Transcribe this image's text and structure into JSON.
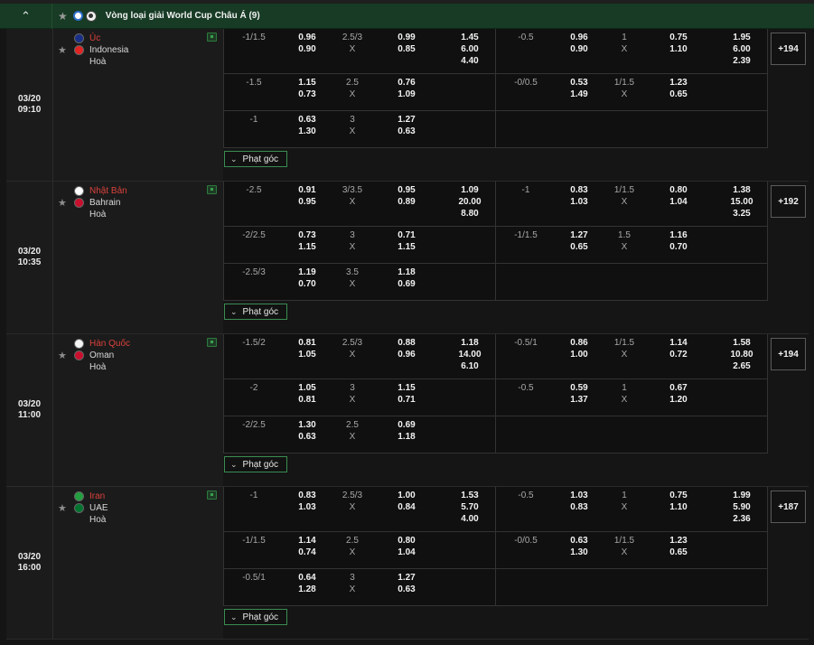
{
  "league": {
    "title": "Vòng loại giải World Cup Châu Á (9)",
    "collapse_icon": "chevron-up-icon",
    "star_icon": "star-icon"
  },
  "corner_label": "Phạt góc",
  "matches": [
    {
      "date": "03/20",
      "time": "09:10",
      "teams": [
        {
          "name": "Úc",
          "fav": true,
          "flag": "#1a2f86"
        },
        {
          "name": "Indonesia",
          "fav": false,
          "flag": "#e02424"
        },
        {
          "name": "Hoà",
          "fav": false,
          "flag": ""
        }
      ],
      "more": "+194",
      "rows": [
        {
          "l_hdp": "-1/1.5",
          "l_o": [
            "0.96",
            "0.90"
          ],
          "l_ou": "2.5/3",
          "l_x": "X",
          "l_uo": [
            "0.99",
            "0.85"
          ],
          "l_1x2": [
            "1.45",
            "6.00",
            "4.40"
          ],
          "r_hdp": "-0.5",
          "r_o": [
            "0.96",
            "0.90"
          ],
          "r_ou": "1",
          "r_x": "X",
          "r_uo": [
            "0.75",
            "1.10"
          ],
          "r_1x2": [
            "1.95",
            "6.00",
            "2.39"
          ]
        },
        {
          "l_hdp": "-1.5",
          "l_o": [
            "1.15",
            "0.73"
          ],
          "l_ou": "2.5",
          "l_x": "X",
          "l_uo": [
            "0.76",
            "1.09"
          ],
          "l_1x2": [
            "",
            "",
            ""
          ],
          "r_hdp": "-0/0.5",
          "r_o": [
            "0.53",
            "1.49"
          ],
          "r_ou": "1/1.5",
          "r_x": "X",
          "r_uo": [
            "1.23",
            "0.65"
          ],
          "r_1x2": [
            "",
            "",
            ""
          ]
        },
        {
          "l_hdp": "-1",
          "l_o": [
            "0.63",
            "1.30"
          ],
          "l_ou": "3",
          "l_x": "X",
          "l_uo": [
            "1.27",
            "0.63"
          ],
          "l_1x2": [
            "",
            "",
            ""
          ],
          "r_hdp": "",
          "r_o": [
            "",
            ""
          ],
          "r_ou": "",
          "r_x": "",
          "r_uo": [
            "",
            ""
          ],
          "r_1x2": [
            "",
            "",
            ""
          ]
        }
      ]
    },
    {
      "date": "03/20",
      "time": "10:35",
      "teams": [
        {
          "name": "Nhật Bản",
          "fav": true,
          "flag": "#ffffff"
        },
        {
          "name": "Bahrain",
          "fav": false,
          "flag": "#c8102e"
        },
        {
          "name": "Hoà",
          "fav": false,
          "flag": ""
        }
      ],
      "more": "+192",
      "rows": [
        {
          "l_hdp": "-2.5",
          "l_o": [
            "0.91",
            "0.95"
          ],
          "l_ou": "3/3.5",
          "l_x": "X",
          "l_uo": [
            "0.95",
            "0.89"
          ],
          "l_1x2": [
            "1.09",
            "20.00",
            "8.80"
          ],
          "r_hdp": "-1",
          "r_o": [
            "0.83",
            "1.03"
          ],
          "r_ou": "1/1.5",
          "r_x": "X",
          "r_uo": [
            "0.80",
            "1.04"
          ],
          "r_1x2": [
            "1.38",
            "15.00",
            "3.25"
          ]
        },
        {
          "l_hdp": "-2/2.5",
          "l_o": [
            "0.73",
            "1.15"
          ],
          "l_ou": "3",
          "l_x": "X",
          "l_uo": [
            "0.71",
            "1.15"
          ],
          "l_1x2": [
            "",
            "",
            ""
          ],
          "r_hdp": "-1/1.5",
          "r_o": [
            "1.27",
            "0.65"
          ],
          "r_ou": "1.5",
          "r_x": "X",
          "r_uo": [
            "1.16",
            "0.70"
          ],
          "r_1x2": [
            "",
            "",
            ""
          ]
        },
        {
          "l_hdp": "-2.5/3",
          "l_o": [
            "1.19",
            "0.70"
          ],
          "l_ou": "3.5",
          "l_x": "X",
          "l_uo": [
            "1.18",
            "0.69"
          ],
          "l_1x2": [
            "",
            "",
            ""
          ],
          "r_hdp": "",
          "r_o": [
            "",
            ""
          ],
          "r_ou": "",
          "r_x": "",
          "r_uo": [
            "",
            ""
          ],
          "r_1x2": [
            "",
            "",
            ""
          ]
        }
      ]
    },
    {
      "date": "03/20",
      "time": "11:00",
      "teams": [
        {
          "name": "Hàn Quốc",
          "fav": true,
          "flag": "#f4f4f4"
        },
        {
          "name": "Oman",
          "fav": false,
          "flag": "#c8102e"
        },
        {
          "name": "Hoà",
          "fav": false,
          "flag": ""
        }
      ],
      "more": "+194",
      "rows": [
        {
          "l_hdp": "-1.5/2",
          "l_o": [
            "0.81",
            "1.05"
          ],
          "l_ou": "2.5/3",
          "l_x": "X",
          "l_uo": [
            "0.88",
            "0.96"
          ],
          "l_1x2": [
            "1.18",
            "14.00",
            "6.10"
          ],
          "r_hdp": "-0.5/1",
          "r_o": [
            "0.86",
            "1.00"
          ],
          "r_ou": "1/1.5",
          "r_x": "X",
          "r_uo": [
            "1.14",
            "0.72"
          ],
          "r_1x2": [
            "1.58",
            "10.80",
            "2.65"
          ]
        },
        {
          "l_hdp": "-2",
          "l_o": [
            "1.05",
            "0.81"
          ],
          "l_ou": "3",
          "l_x": "X",
          "l_uo": [
            "1.15",
            "0.71"
          ],
          "l_1x2": [
            "",
            "",
            ""
          ],
          "r_hdp": "-0.5",
          "r_o": [
            "0.59",
            "1.37"
          ],
          "r_ou": "1",
          "r_x": "X",
          "r_uo": [
            "0.67",
            "1.20"
          ],
          "r_1x2": [
            "",
            "",
            ""
          ]
        },
        {
          "l_hdp": "-2/2.5",
          "l_o": [
            "1.30",
            "0.63"
          ],
          "l_ou": "2.5",
          "l_x": "X",
          "l_uo": [
            "0.69",
            "1.18"
          ],
          "l_1x2": [
            "",
            "",
            ""
          ],
          "r_hdp": "",
          "r_o": [
            "",
            ""
          ],
          "r_ou": "",
          "r_x": "",
          "r_uo": [
            "",
            ""
          ],
          "r_1x2": [
            "",
            "",
            ""
          ]
        }
      ]
    },
    {
      "date": "03/20",
      "time": "16:00",
      "teams": [
        {
          "name": "Iran",
          "fav": true,
          "flag": "#239f40"
        },
        {
          "name": "UAE",
          "fav": false,
          "flag": "#00732f"
        },
        {
          "name": "Hoà",
          "fav": false,
          "flag": ""
        }
      ],
      "more": "+187",
      "rows": [
        {
          "l_hdp": "-1",
          "l_o": [
            "0.83",
            "1.03"
          ],
          "l_ou": "2.5/3",
          "l_x": "X",
          "l_uo": [
            "1.00",
            "0.84"
          ],
          "l_1x2": [
            "1.53",
            "5.70",
            "4.00"
          ],
          "r_hdp": "-0.5",
          "r_o": [
            "1.03",
            "0.83"
          ],
          "r_ou": "1",
          "r_x": "X",
          "r_uo": [
            "0.75",
            "1.10"
          ],
          "r_1x2": [
            "1.99",
            "5.90",
            "2.36"
          ]
        },
        {
          "l_hdp": "-1/1.5",
          "l_o": [
            "1.14",
            "0.74"
          ],
          "l_ou": "2.5",
          "l_x": "X",
          "l_uo": [
            "0.80",
            "1.04"
          ],
          "l_1x2": [
            "",
            "",
            ""
          ],
          "r_hdp": "-0/0.5",
          "r_o": [
            "0.63",
            "1.30"
          ],
          "r_ou": "1/1.5",
          "r_x": "X",
          "r_uo": [
            "1.23",
            "0.65"
          ],
          "r_1x2": [
            "",
            "",
            ""
          ]
        },
        {
          "l_hdp": "-0.5/1",
          "l_o": [
            "0.64",
            "1.28"
          ],
          "l_ou": "3",
          "l_x": "X",
          "l_uo": [
            "1.27",
            "0.63"
          ],
          "l_1x2": [
            "",
            "",
            ""
          ],
          "r_hdp": "",
          "r_o": [
            "",
            ""
          ],
          "r_ou": "",
          "r_x": "",
          "r_uo": [
            "",
            ""
          ],
          "r_1x2": [
            "",
            "",
            ""
          ]
        }
      ]
    }
  ]
}
